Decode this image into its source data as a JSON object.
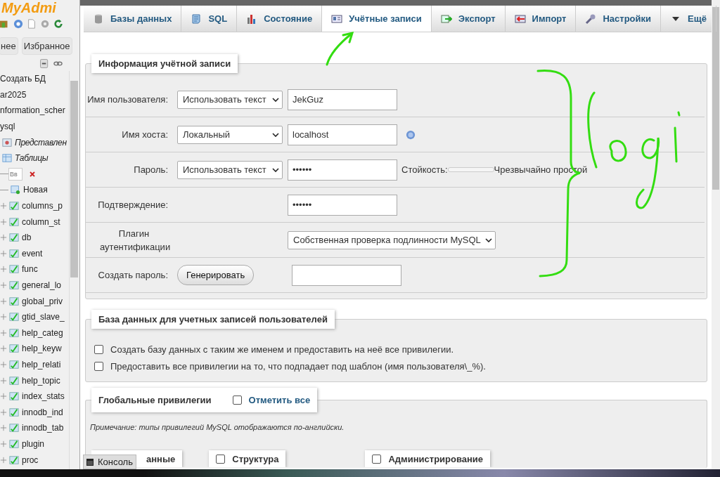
{
  "sidebar": {
    "logo": "MyAdmi",
    "nav_buttons": [
      {
        "label": "нее"
      },
      {
        "label": "Избранное"
      }
    ],
    "tree": [
      {
        "label": "Создать БД"
      },
      {
        "label": "ar2025"
      },
      {
        "label": "nformation_scher"
      },
      {
        "label": "ysql",
        "children": [
          {
            "label": "Представлен",
            "kind": "views"
          },
          {
            "label": "Таблицы",
            "kind": "tables",
            "children": [
              {
                "kind": "filter",
                "placeholder": "Вв"
              },
              {
                "label": "Новая",
                "kind": "new-table"
              },
              {
                "label": "columns_p",
                "kind": "table"
              },
              {
                "label": "column_st",
                "kind": "table"
              },
              {
                "label": "db",
                "kind": "table"
              },
              {
                "label": "event",
                "kind": "table"
              },
              {
                "label": "func",
                "kind": "table"
              },
              {
                "label": "general_lo",
                "kind": "table"
              },
              {
                "label": "global_priv",
                "kind": "table"
              },
              {
                "label": "gtid_slave_",
                "kind": "table"
              },
              {
                "label": "help_categ",
                "kind": "table"
              },
              {
                "label": "help_keyw",
                "kind": "table"
              },
              {
                "label": "help_relati",
                "kind": "table"
              },
              {
                "label": "help_topic",
                "kind": "table"
              },
              {
                "label": "index_stats",
                "kind": "table"
              },
              {
                "label": "innodb_ind",
                "kind": "table"
              },
              {
                "label": "innodb_tab",
                "kind": "table"
              },
              {
                "label": "plugin",
                "kind": "table"
              },
              {
                "label": "proc",
                "kind": "table"
              }
            ]
          }
        ]
      }
    ]
  },
  "tabs": [
    {
      "label": "Базы данных",
      "kind": "databases",
      "selected": false
    },
    {
      "label": "SQL",
      "kind": "sql",
      "selected": false
    },
    {
      "label": "Состояние",
      "kind": "status",
      "selected": false
    },
    {
      "label": "Учётные записи",
      "kind": "accounts",
      "selected": true
    },
    {
      "label": "Экспорт",
      "kind": "export",
      "selected": false
    },
    {
      "label": "Импорт",
      "kind": "import",
      "selected": false
    },
    {
      "label": "Настройки",
      "kind": "settings",
      "selected": false
    },
    {
      "label": "Ещё",
      "kind": "more",
      "selected": false
    }
  ],
  "account": {
    "legend": "Информация учётной записи",
    "rows": [
      {
        "kind": "user",
        "label": "Имя пользователя:",
        "select": "Использовать текст",
        "value": "JekGuz"
      },
      {
        "kind": "host",
        "label": "Имя хоста:",
        "select": "Локальный",
        "value": "localhost"
      },
      {
        "kind": "password",
        "label": "Пароль:",
        "select": "Использовать текст",
        "value": "••••••",
        "strength_label": "Стойкость:",
        "level": 0,
        "strength_text": "Чрезвычайно простой"
      },
      {
        "kind": "confirm",
        "label": "Подтверждение:",
        "value": "••••••"
      },
      {
        "kind": "plugin",
        "label": "Плагин аутентификации",
        "select": "Собственная проверка подлинности MySQL"
      },
      {
        "kind": "generate",
        "label": "Создать пароль:",
        "button": "Генерировать"
      }
    ]
  },
  "database": {
    "legend": "База данных для учетных записей пользователей",
    "options": [
      {
        "label": "Создать базу данных с таким же именем и предоставить на неё все привилегии.",
        "checked": false
      },
      {
        "label": "Предоставить все привилегии на то, что подпадает под шаблон (имя пользователя\\_%).",
        "checked": false
      }
    ]
  },
  "global": {
    "legend": "Глобальные привилегии",
    "check_all": {
      "label": "Отметить все",
      "checked": false
    },
    "note": "Примечание: типы привилегий MySQL отображаются по-английски.",
    "groups": [
      {
        "label": "анные"
      },
      {
        "label": "Структура",
        "checked": false
      },
      {
        "label": "Администрирование",
        "checked": false
      }
    ]
  },
  "console": {
    "label": "Консоль"
  }
}
